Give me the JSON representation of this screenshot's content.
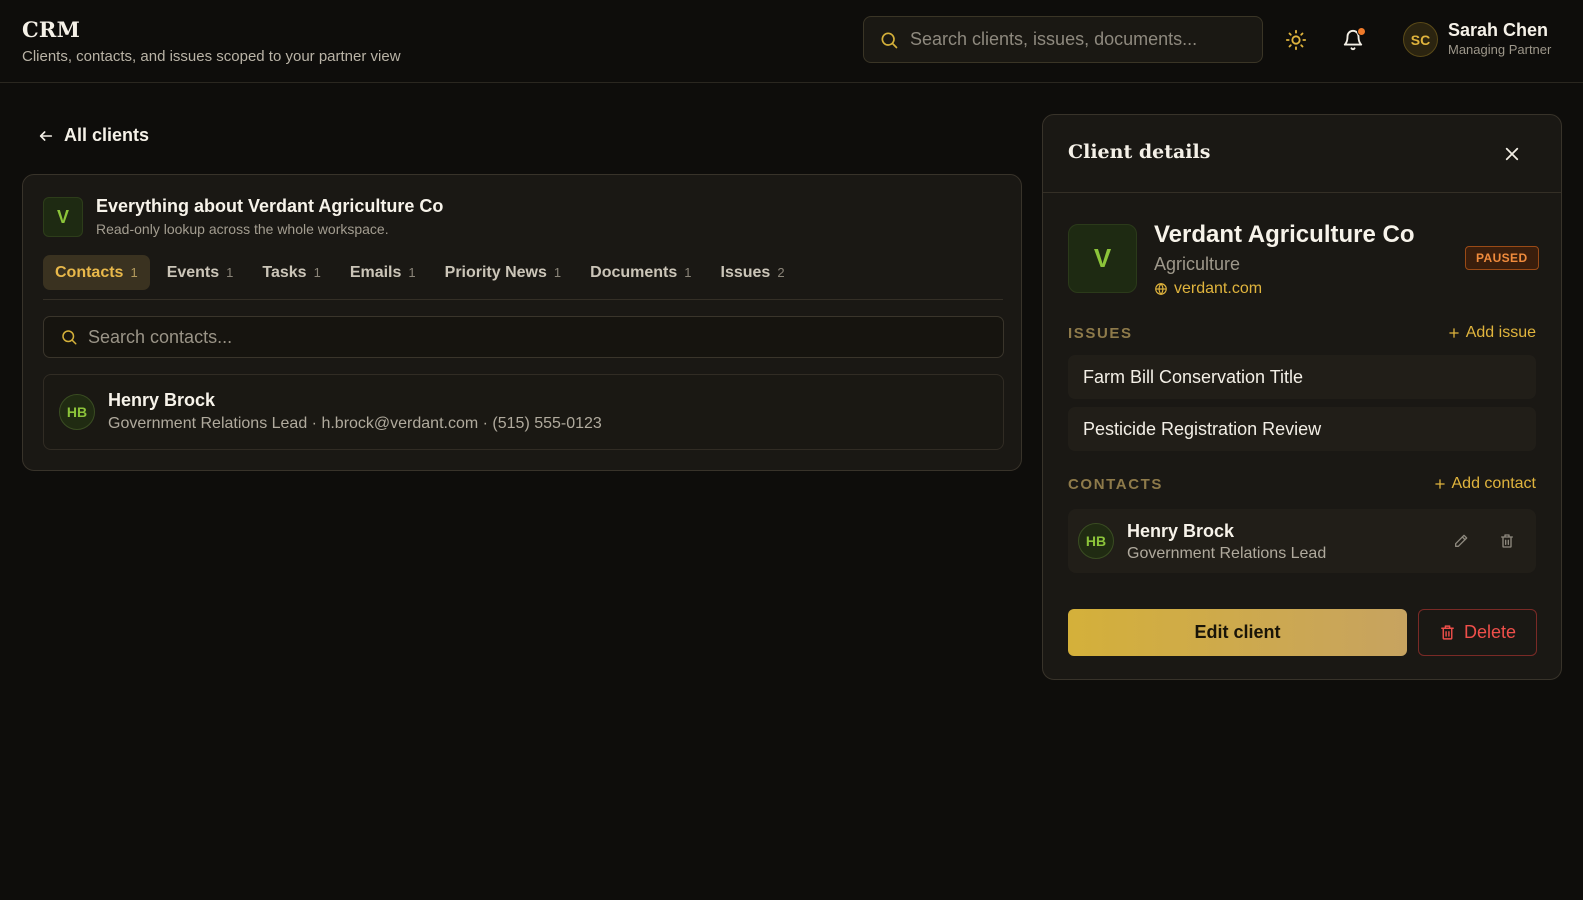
{
  "header": {
    "app_title": "CRM",
    "subtitle": "Clients, contacts, and issues scoped to your partner view",
    "search_placeholder": "Search clients, issues, documents...",
    "user": {
      "initials": "SC",
      "name": "Sarah Chen",
      "role": "Managing Partner"
    },
    "has_notifications": true
  },
  "back_link": {
    "label": "All clients"
  },
  "main": {
    "avatar_letter": "V",
    "title": "Everything about Verdant Agriculture Co",
    "subtitle": "Read-only lookup across the whole workspace.",
    "tabs": [
      {
        "label": "Contacts",
        "count": "1",
        "active": true
      },
      {
        "label": "Events",
        "count": "1"
      },
      {
        "label": "Tasks",
        "count": "1"
      },
      {
        "label": "Emails",
        "count": "1"
      },
      {
        "label": "Priority News",
        "count": "1"
      },
      {
        "label": "Documents",
        "count": "1"
      },
      {
        "label": "Issues",
        "count": "2"
      }
    ],
    "search_placeholder": "Search contacts...",
    "contacts": [
      {
        "initials": "HB",
        "name": "Henry Brock",
        "meta": "Government Relations Lead · h.brock@verdant.com · (515) 555-0123"
      }
    ]
  },
  "panel": {
    "title": "Client details",
    "client": {
      "avatar_letter": "V",
      "name": "Verdant Agriculture Co",
      "industry": "Agriculture",
      "website": "verdant.com",
      "status": "PAUSED"
    },
    "issues_label": "ISSUES",
    "add_issue_label": "Add issue",
    "issues": [
      "Farm Bill Conservation Title",
      "Pesticide Registration Review"
    ],
    "contacts_label": "CONTACTS",
    "add_contact_label": "Add contact",
    "contact": {
      "initials": "HB",
      "name": "Henry Brock",
      "title": "Government Relations Lead"
    },
    "edit_label": "Edit client",
    "delete_label": "Delete"
  },
  "colors": {
    "background": "#0e0d0b",
    "accent_gold": "#e0b43d",
    "status_paused": "#f08b3c",
    "danger": "#ef4f4a",
    "avatar_green": "#8cc43a"
  }
}
